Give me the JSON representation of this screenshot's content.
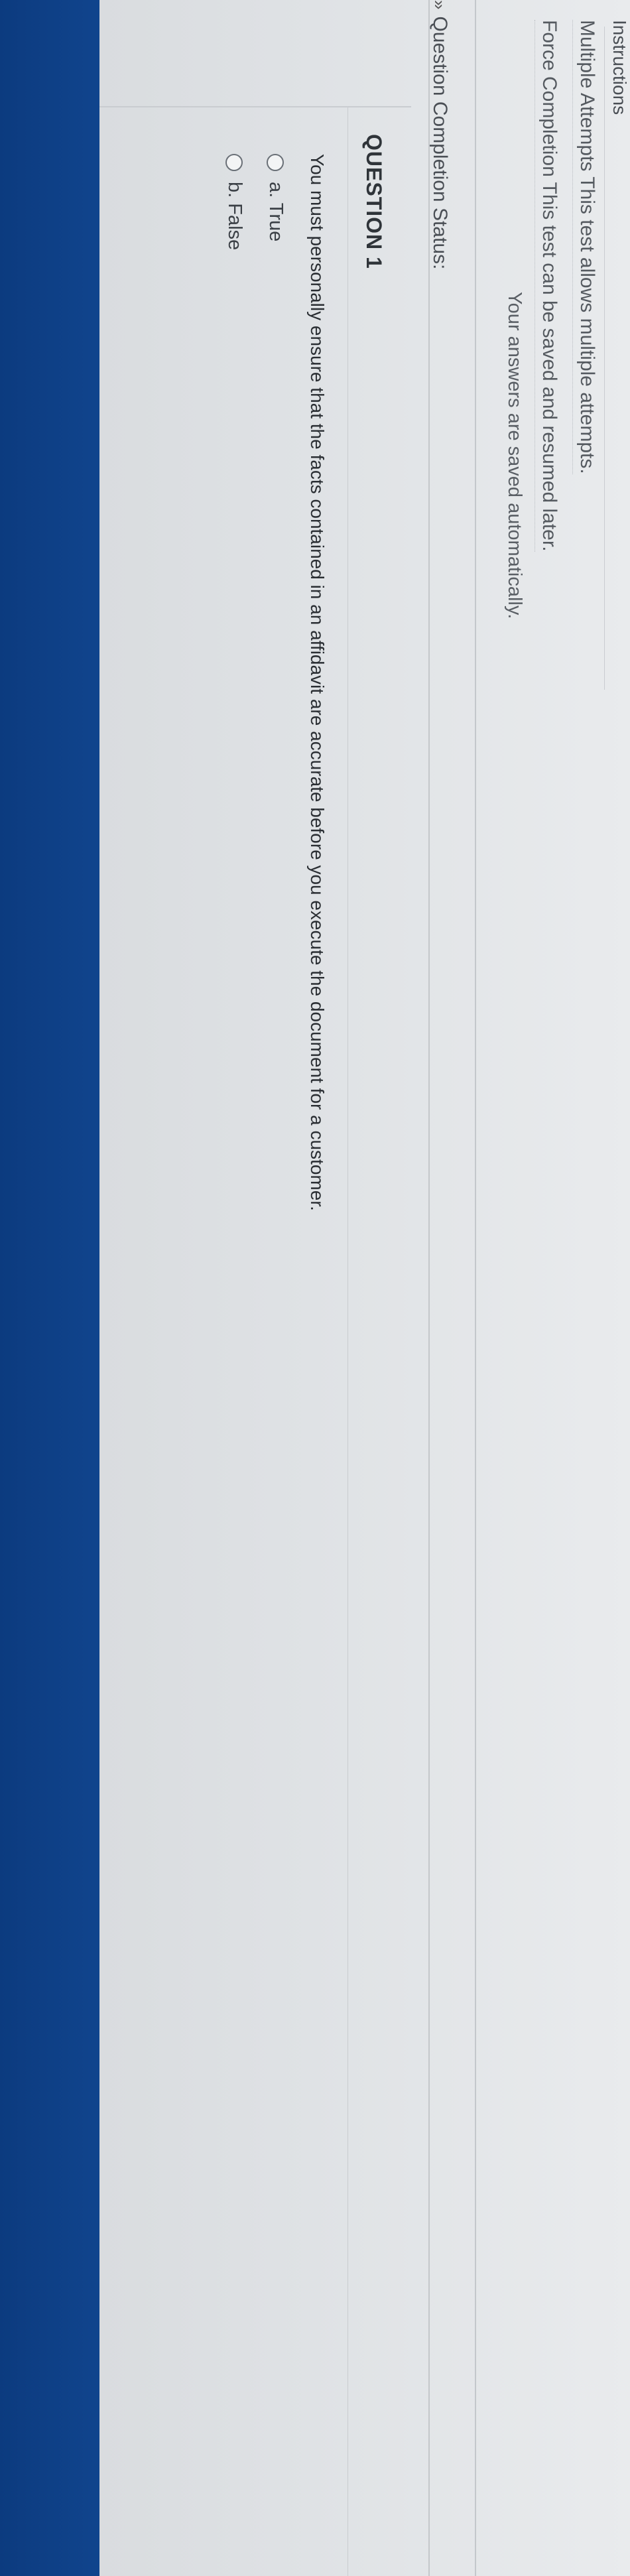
{
  "instructions": {
    "title": "Instructions",
    "multiple_attempts": "Multiple Attempts This test allows multiple attempts.",
    "force_completion": "Force Completion This test can be saved and resumed later."
  },
  "autosave_note": "Your answers are saved automatically.",
  "status": {
    "label": "Question Completion Status:",
    "chevron": "»"
  },
  "question": {
    "title": "QUESTION 1",
    "text": "You must personally ensure that the facts contained in an affidavit are accurate before you execute the document for a customer.",
    "options": [
      {
        "label": "a. True"
      },
      {
        "label": "b. False"
      }
    ]
  }
}
